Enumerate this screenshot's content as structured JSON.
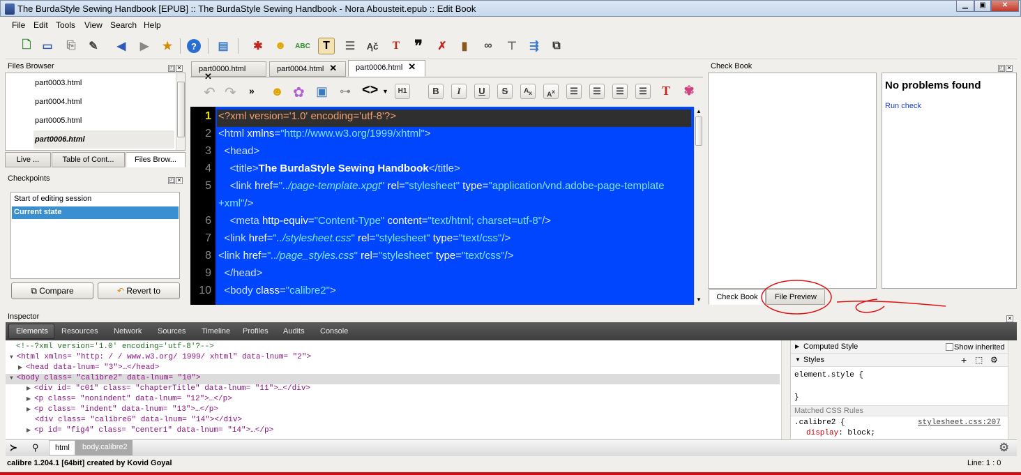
{
  "window": {
    "title": "The BurdaStyle Sewing Handbook [EPUB] :: The BurdaStyle Sewing Handbook - Nora Abousteit.epub :: Edit Book"
  },
  "menubar": [
    "File",
    "Edit",
    "Tools",
    "View",
    "Search",
    "Help"
  ],
  "files_browser": {
    "title": "Files Browser",
    "items": [
      "part0003.html",
      "part0004.html",
      "part0005.html",
      "part0006.html"
    ],
    "selected": "part0006.html",
    "bottom_tabs": [
      "Live ...",
      "Table of Cont...",
      "Files Brow..."
    ]
  },
  "checkpoints": {
    "title": "Checkpoints",
    "items": [
      "Start of editing session",
      "Current state"
    ],
    "compare_label": "Compare",
    "revert_label": "Revert to"
  },
  "editor": {
    "tabs": [
      "part0000.html",
      "part0004.html",
      "part0006.html"
    ],
    "active_tab": "part0006.html",
    "line_numbers": [
      "1",
      "2",
      "3",
      "4",
      "5",
      "",
      "6",
      "7",
      "8",
      "9",
      "10"
    ],
    "lines": [
      {
        "parts": [
          [
            "tag",
            "<?xml version='1.0' encoding='utf-8'?>"
          ]
        ]
      },
      {
        "parts": [
          [
            "tag",
            "<html "
          ],
          [
            "attr",
            "xmlns"
          ],
          [
            "tag",
            "="
          ],
          [
            "str",
            "\"http://www.w3.org/1999/xhtml\""
          ],
          [
            "tag",
            ">"
          ]
        ]
      },
      {
        "parts": [
          [
            "tag",
            "  <head>"
          ]
        ]
      },
      {
        "parts": [
          [
            "tag",
            "    <title>"
          ],
          [
            "bold",
            "The BurdaStyle Sewing Handbook"
          ],
          [
            "tag",
            "</title>"
          ]
        ]
      },
      {
        "parts": [
          [
            "tag",
            "    <link "
          ],
          [
            "attr",
            "href"
          ],
          [
            "tag",
            "="
          ],
          [
            "str",
            "\""
          ],
          [
            "strit",
            "../page-template.xpgt"
          ],
          [
            "str",
            "\""
          ],
          [
            "tag",
            " "
          ],
          [
            "attr",
            "rel"
          ],
          [
            "tag",
            "="
          ],
          [
            "str",
            "\"stylesheet\""
          ],
          [
            "tag",
            " "
          ],
          [
            "attr",
            "type"
          ],
          [
            "tag",
            "="
          ],
          [
            "str",
            "\"application/vnd.adobe-page-template"
          ]
        ]
      },
      {
        "parts": [
          [
            "str",
            "+xml\""
          ],
          [
            "tag",
            "/>"
          ]
        ]
      },
      {
        "parts": [
          [
            "tag",
            "    <meta "
          ],
          [
            "attr",
            "http-equiv"
          ],
          [
            "tag",
            "="
          ],
          [
            "str",
            "\"Content-Type\""
          ],
          [
            "tag",
            " "
          ],
          [
            "attr",
            "content"
          ],
          [
            "tag",
            "="
          ],
          [
            "str",
            "\"text/html; charset=utf-8\""
          ],
          [
            "tag",
            "/>"
          ]
        ]
      },
      {
        "parts": [
          [
            "tag",
            "  <link "
          ],
          [
            "attr",
            "href"
          ],
          [
            "tag",
            "="
          ],
          [
            "str",
            "\""
          ],
          [
            "strit",
            "../stylesheet.css"
          ],
          [
            "str",
            "\""
          ],
          [
            "tag",
            " "
          ],
          [
            "attr",
            "rel"
          ],
          [
            "tag",
            "="
          ],
          [
            "str",
            "\"stylesheet\""
          ],
          [
            "tag",
            " "
          ],
          [
            "attr",
            "type"
          ],
          [
            "tag",
            "="
          ],
          [
            "str",
            "\"text/css\""
          ],
          [
            "tag",
            "/>"
          ]
        ]
      },
      {
        "parts": [
          [
            "tag",
            "<link "
          ],
          [
            "attr",
            "href"
          ],
          [
            "tag",
            "="
          ],
          [
            "str",
            "\""
          ],
          [
            "strit",
            "../page_styles.css"
          ],
          [
            "str",
            "\""
          ],
          [
            "tag",
            " "
          ],
          [
            "attr",
            "rel"
          ],
          [
            "tag",
            "="
          ],
          [
            "str",
            "\"stylesheet\""
          ],
          [
            "tag",
            " "
          ],
          [
            "attr",
            "type"
          ],
          [
            "tag",
            "="
          ],
          [
            "str",
            "\"text/css\""
          ],
          [
            "tag",
            "/>"
          ]
        ]
      },
      {
        "parts": [
          [
            "tag",
            "  </head>"
          ]
        ]
      },
      {
        "parts": [
          [
            "tag",
            "  <body "
          ],
          [
            "attr",
            "class"
          ],
          [
            "tag",
            "="
          ],
          [
            "str",
            "\"calibre2\""
          ],
          [
            "tag",
            ">"
          ]
        ]
      }
    ]
  },
  "check_book": {
    "title": "Check Book",
    "result": "No problems found",
    "run_check": "Run check",
    "bottom_tabs": [
      "Check Book",
      "File Preview"
    ]
  },
  "inspector": {
    "title": "Inspector",
    "tabs": [
      "Elements",
      "Resources",
      "Network",
      "Sources",
      "Timeline",
      "Profiles",
      "Audits",
      "Console"
    ],
    "active_tab": "Elements",
    "dom_lines": [
      "<!--?xml version='1.0' encoding='utf-8'?-->",
      "<html xmlns= \"http: / / www.w3.org/ 1999/ xhtml\" data-lnum= \"2\">",
      "<head data-lnum= \"3\">…</head>",
      "<body class= \"calibre2\" data-lnum= \"10\">",
      "<div id= \"c01\" class= \"chapterTitle\" data-lnum= \"11\">…</div>",
      "<p class= \"nonindent\" data-lnum= \"12\">…</p>",
      "<p class= \"indent\" data-lnum= \"13\">…</p>",
      "<div class= \"calibre6\" data-lnum= \"14\"></div>",
      "<p id= \"fig4\" class= \"center1\" data-lnum= \"14\">…</p>"
    ],
    "breadcrumbs": [
      "html",
      "body.calibre2"
    ],
    "styles": {
      "computed_style": "Computed Style",
      "show_inherited": "Show inherited",
      "styles_label": "Styles",
      "element_style": "element.style {",
      "element_style_close": "}",
      "matched_rules": "Matched CSS Rules",
      "rule_selector": ".calibre2 {",
      "rule_source": "stylesheet.css:207",
      "rule_prop": "display",
      "rule_value": "block;"
    }
  },
  "status": {
    "left": "calibre 1.204.1 [64bit] created by Kovid Goyal",
    "right": "Line: 1 : 0"
  }
}
